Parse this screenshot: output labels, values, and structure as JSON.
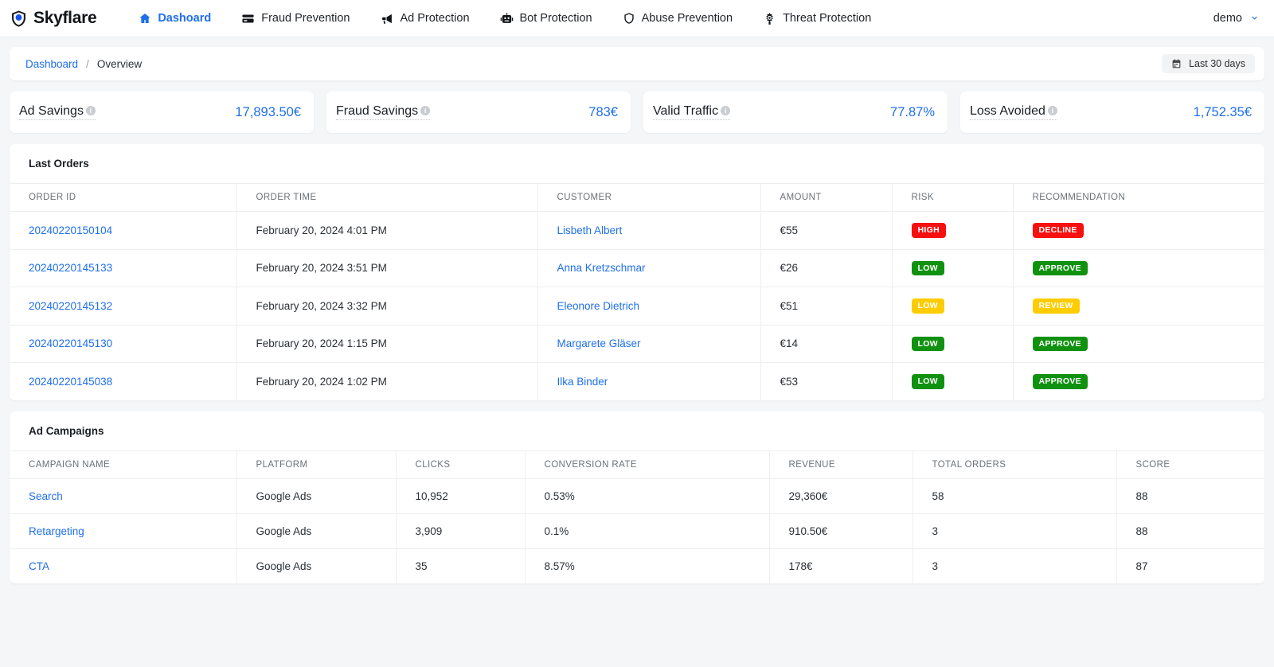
{
  "brand": {
    "name": "Skyflare",
    "logo_icon": "shield-eye-icon"
  },
  "nav": {
    "items": [
      {
        "label": "Dashoard",
        "icon": "home-icon",
        "active": true
      },
      {
        "label": "Fraud Prevention",
        "icon": "credit-card-icon",
        "active": false
      },
      {
        "label": "Ad Protection",
        "icon": "megaphone-icon",
        "active": false
      },
      {
        "label": "Bot Protection",
        "icon": "robot-icon",
        "active": false
      },
      {
        "label": "Abuse Prevention",
        "icon": "shield-icon",
        "active": false
      },
      {
        "label": "Threat Protection",
        "icon": "virus-icon",
        "active": false
      }
    ]
  },
  "account": {
    "name": "demo",
    "icon": "chevron-down-icon"
  },
  "breadcrumb": {
    "root": "Dashboard",
    "separator": "/",
    "current": "Overview"
  },
  "daterange": {
    "label": "Last 30 days",
    "icon": "calendar-icon"
  },
  "kpis": [
    {
      "label": "Ad Savings",
      "value": "17,893.50€",
      "info_icon": "info-icon"
    },
    {
      "label": "Fraud Savings",
      "value": "783€",
      "info_icon": "info-icon"
    },
    {
      "label": "Valid Traffic",
      "value": "77.87%",
      "info_icon": "info-icon"
    },
    {
      "label": "Loss Avoided",
      "value": "1,752.35€",
      "info_icon": "info-icon"
    }
  ],
  "orders": {
    "title": "Last Orders",
    "columns": [
      "ORDER ID",
      "ORDER TIME",
      "CUSTOMER",
      "AMOUNT",
      "RISK",
      "RECOMMENDATION"
    ],
    "rows": [
      {
        "id": "20240220150104",
        "time": "February 20, 2024 4:01 PM",
        "customer": "Lisbeth Albert",
        "amount": "€55",
        "risk": "HIGH",
        "risk_color": "#f80f0f",
        "recommendation": "DECLINE",
        "rec_color": "#f80f0f"
      },
      {
        "id": "20240220145133",
        "time": "February 20, 2024 3:51 PM",
        "customer": "Anna Kretzschmar",
        "amount": "€26",
        "risk": "LOW",
        "risk_color": "#109110",
        "recommendation": "APPROVE",
        "rec_color": "#109110"
      },
      {
        "id": "20240220145132",
        "time": "February 20, 2024 3:32 PM",
        "customer": "Eleonore Dietrich",
        "amount": "€51",
        "risk": "LOW",
        "risk_color": "#ffcc00",
        "recommendation": "REVIEW",
        "rec_color": "#ffcc00"
      },
      {
        "id": "20240220145130",
        "time": "February 20, 2024 1:15 PM",
        "customer": "Margarete Gläser",
        "amount": "€14",
        "risk": "LOW",
        "risk_color": "#109110",
        "recommendation": "APPROVE",
        "rec_color": "#109110"
      },
      {
        "id": "20240220145038",
        "time": "February 20, 2024 1:02 PM",
        "customer": "Ilka Binder",
        "amount": "€53",
        "risk": "LOW",
        "risk_color": "#109110",
        "recommendation": "APPROVE",
        "rec_color": "#109110"
      }
    ]
  },
  "campaigns": {
    "title": "Ad Campaigns",
    "columns": [
      "CAMPAIGN NAME",
      "PLATFORM",
      "CLICKS",
      "CONVERSION RATE",
      "REVENUE",
      "TOTAL ORDERS",
      "SCORE"
    ],
    "rows": [
      {
        "name": "Search",
        "platform": "Google Ads",
        "clicks": "10,952",
        "conversion_rate": "0.53%",
        "revenue": "29,360€",
        "total_orders": "58",
        "score": "88"
      },
      {
        "name": "Retargeting",
        "platform": "Google Ads",
        "clicks": "3,909",
        "conversion_rate": "0.1%",
        "revenue": "910.50€",
        "total_orders": "3",
        "score": "88"
      },
      {
        "name": "CTA",
        "platform": "Google Ads",
        "clicks": "35",
        "conversion_rate": "8.57%",
        "revenue": "178€",
        "total_orders": "3",
        "score": "87"
      }
    ]
  },
  "colors": {
    "accent": "#1f6feb",
    "danger": "#f80f0f",
    "success": "#109110",
    "warning": "#ffcc00"
  }
}
